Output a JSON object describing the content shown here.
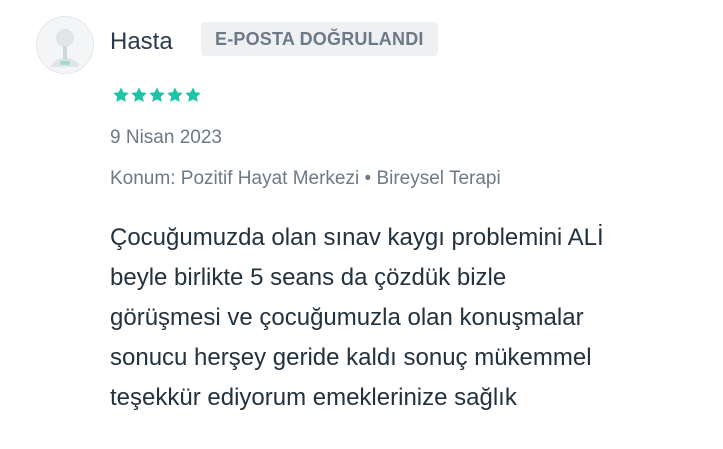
{
  "review": {
    "author": {
      "name": "Hasta",
      "avatar_icon": "user-avatar-icon"
    },
    "badge": "E-POSTA DOĞRULANDI",
    "rating": {
      "stars": 5,
      "max": 5,
      "color": "#1fc4a6"
    },
    "date": "9 Nisan 2023",
    "meta": {
      "location_label": "Konum:",
      "location_value": "Pozitif Hayat Merkezi",
      "separator": "•",
      "service": "Bireysel Terapi"
    },
    "text_lines": [
      "Çocuğumuzda olan sınav kaygı problemini ALİ",
      "beyle birlikte 5 seans da çözdük bizle",
      "görüşmesi ve çocuğumuzla olan konuşmalar",
      "sonucu herşey geride kaldı sonuç mükemmel",
      "teşekkür ediyorum emeklerinize sağlık"
    ]
  }
}
